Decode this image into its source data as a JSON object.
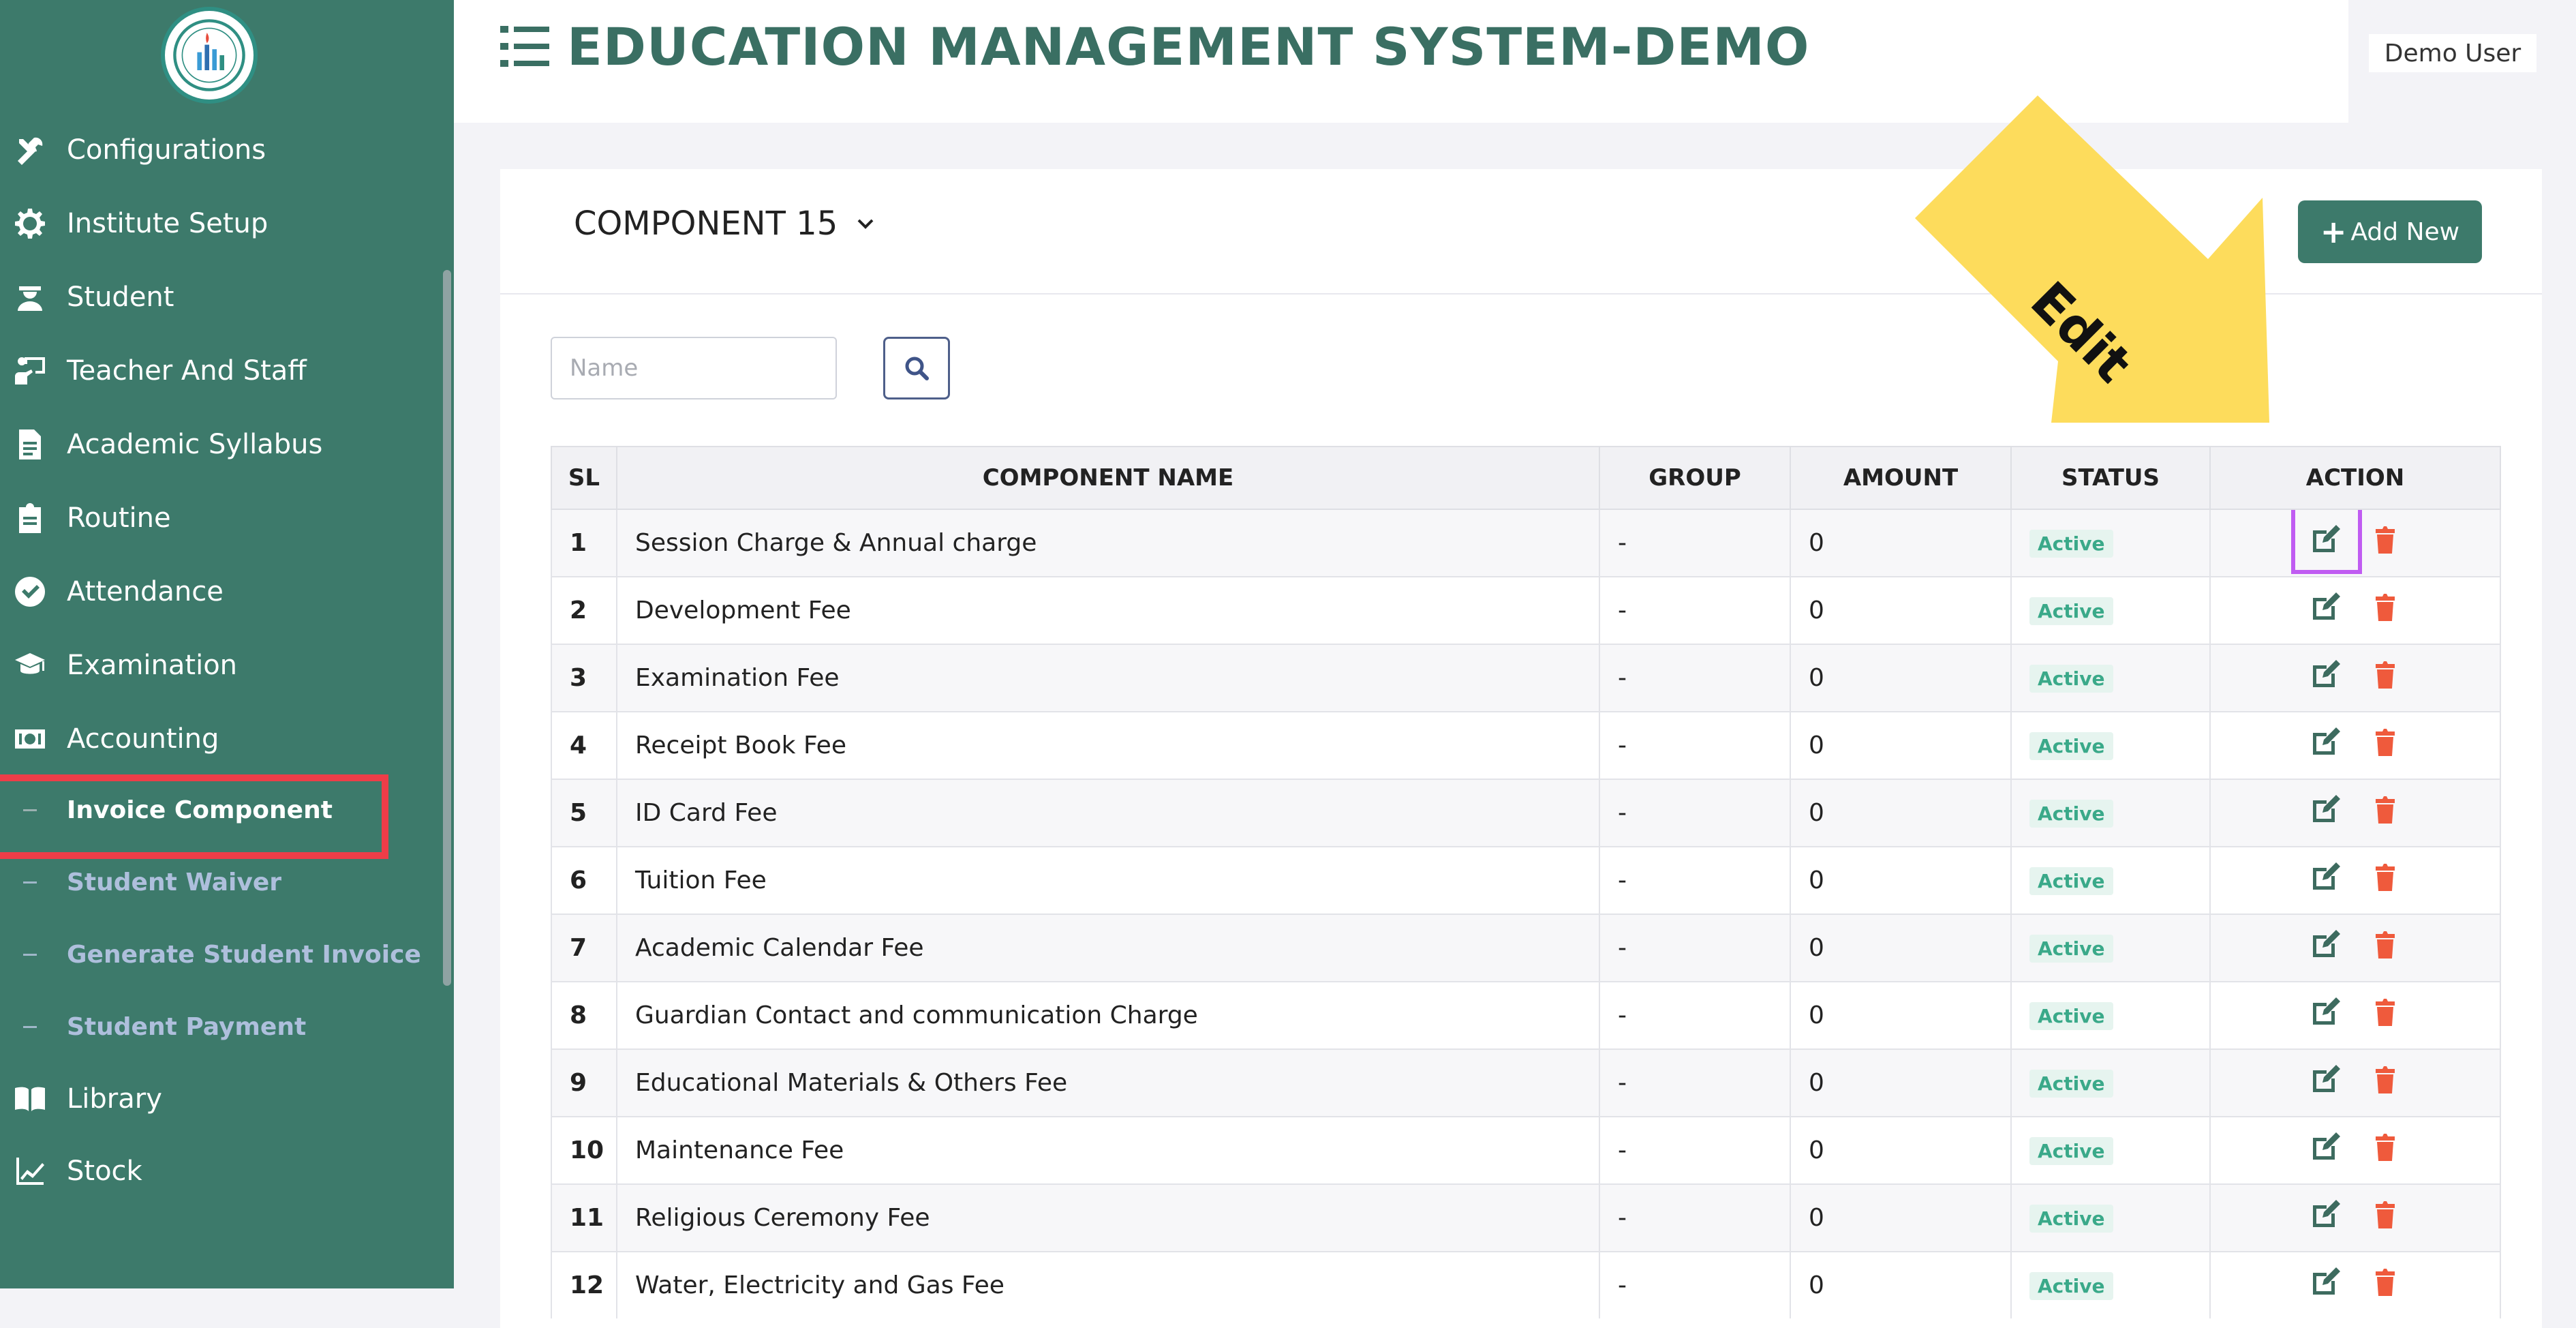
{
  "header": {
    "title": "EDUCATION MANAGEMENT SYSTEM-DEMO",
    "user": "Demo User"
  },
  "sidebar": {
    "items": [
      {
        "label": "Configurations",
        "icon": "tools-icon"
      },
      {
        "label": "Institute Setup",
        "icon": "gear-icon"
      },
      {
        "label": "Student",
        "icon": "student-icon"
      },
      {
        "label": "Teacher And Staff",
        "icon": "teacher-icon"
      },
      {
        "label": "Academic Syllabus",
        "icon": "document-icon"
      },
      {
        "label": "Routine",
        "icon": "clipboard-icon"
      },
      {
        "label": "Attendance",
        "icon": "check-circle-icon"
      },
      {
        "label": "Examination",
        "icon": "graduation-cap-icon"
      },
      {
        "label": "Accounting",
        "icon": "money-icon"
      }
    ],
    "sub_items": [
      {
        "label": "Invoice Component",
        "active": true
      },
      {
        "label": "Student Waiver",
        "active": false
      },
      {
        "label": "Generate Student Invoice",
        "active": false
      },
      {
        "label": "Student Payment",
        "active": false
      }
    ],
    "bottom_items": [
      {
        "label": "Library",
        "icon": "book-icon"
      },
      {
        "label": "Stock",
        "icon": "chart-line-icon"
      }
    ],
    "active_highlight_color": "#ee3d48"
  },
  "toolbar": {
    "component_select": "COMPONENT 15",
    "add_button": "Add New",
    "search_placeholder": "Name"
  },
  "table": {
    "columns": [
      "SL",
      "COMPONENT NAME",
      "GROUP",
      "AMOUNT",
      "STATUS",
      "ACTION"
    ],
    "rows": [
      {
        "sl": "1",
        "name": "Session Charge & Annual charge",
        "group": "-",
        "amount": "0",
        "status": "Active"
      },
      {
        "sl": "2",
        "name": "Development Fee",
        "group": "-",
        "amount": "0",
        "status": "Active"
      },
      {
        "sl": "3",
        "name": "Examination Fee",
        "group": "-",
        "amount": "0",
        "status": "Active"
      },
      {
        "sl": "4",
        "name": "Receipt Book Fee",
        "group": "-",
        "amount": "0",
        "status": "Active"
      },
      {
        "sl": "5",
        "name": "ID Card Fee",
        "group": "-",
        "amount": "0",
        "status": "Active"
      },
      {
        "sl": "6",
        "name": "Tuition Fee",
        "group": "-",
        "amount": "0",
        "status": "Active"
      },
      {
        "sl": "7",
        "name": "Academic Calendar Fee",
        "group": "-",
        "amount": "0",
        "status": "Active"
      },
      {
        "sl": "8",
        "name": "Guardian Contact and communication Charge",
        "group": "-",
        "amount": "0",
        "status": "Active"
      },
      {
        "sl": "9",
        "name": "Educational Materials & Others Fee",
        "group": "-",
        "amount": "0",
        "status": "Active"
      },
      {
        "sl": "10",
        "name": "Maintenance Fee",
        "group": "-",
        "amount": "0",
        "status": "Active"
      },
      {
        "sl": "11",
        "name": "Religious Ceremony Fee",
        "group": "-",
        "amount": "0",
        "status": "Active"
      },
      {
        "sl": "12",
        "name": "Water, Electricity and Gas Fee",
        "group": "-",
        "amount": "0",
        "status": "Active"
      }
    ]
  },
  "annotation": {
    "callout_text": "Edit",
    "callout_color": "#fddc5c",
    "highlight_color": "#c05cf2"
  },
  "colors": {
    "brand": "#3d7a6b",
    "title": "#3a6f63",
    "delete": "#ef5a3c",
    "edit": "#3d6b5f"
  }
}
